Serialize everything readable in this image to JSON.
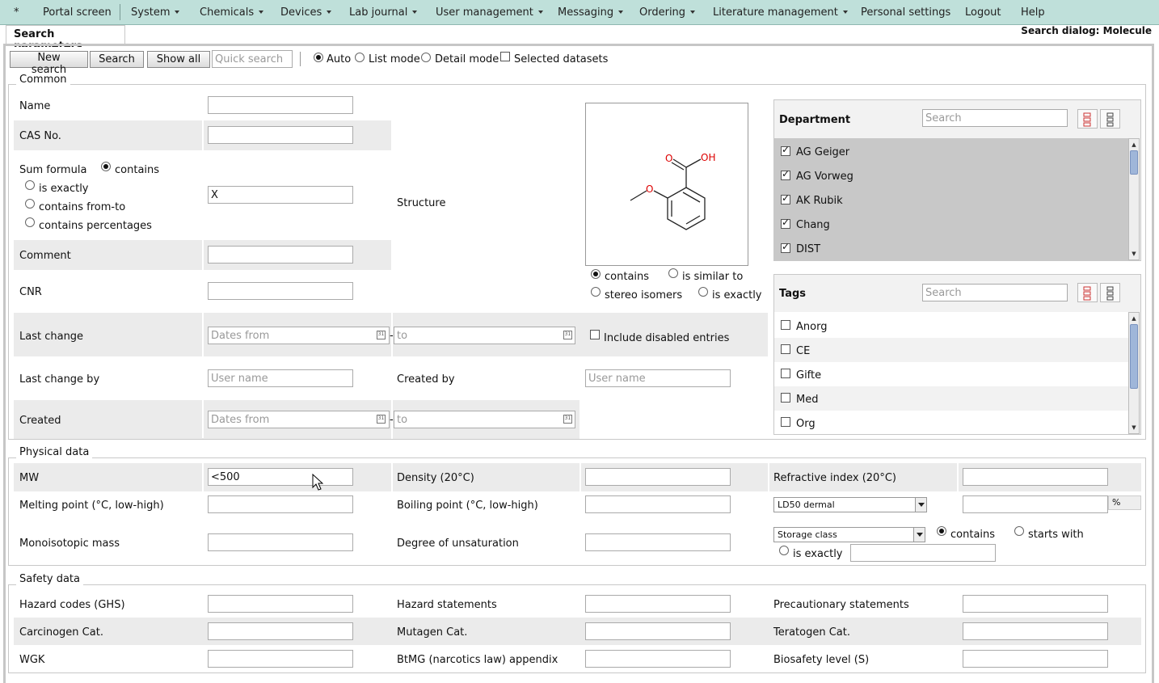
{
  "menu": {
    "home": "*",
    "items": [
      {
        "label": "Portal screen",
        "dropdown": false
      },
      {
        "label": "System",
        "dropdown": true
      },
      {
        "label": "Chemicals",
        "dropdown": true
      },
      {
        "label": "Devices",
        "dropdown": true
      },
      {
        "label": "Lab journal",
        "dropdown": true
      },
      {
        "label": "User management",
        "dropdown": true
      },
      {
        "label": "Messaging",
        "dropdown": true
      },
      {
        "label": "Ordering",
        "dropdown": true
      },
      {
        "label": "Literature management",
        "dropdown": true
      },
      {
        "label": "Personal settings",
        "dropdown": false
      },
      {
        "label": "Logout",
        "dropdown": false
      },
      {
        "label": "Help",
        "dropdown": false
      }
    ]
  },
  "tab": {
    "label": "Search parameters"
  },
  "dialog_title": "Search dialog: Molecule",
  "toolbar": {
    "new_search": "New search",
    "search": "Search",
    "show_all": "Show all",
    "quick_search_placeholder": "Quick search",
    "mode_auto": "Auto",
    "mode_list": "List mode",
    "mode_detail": "Detail mode",
    "mode_selected": "auto",
    "selected_datasets": "Selected datasets",
    "selected_datasets_checked": false
  },
  "common": {
    "legend": "Common",
    "name_label": "Name",
    "name_value": "",
    "cas_label": "CAS No.",
    "cas_value": "",
    "sum_formula_label": "Sum formula",
    "sf_contains": "contains",
    "sf_is_exactly": "is exactly",
    "sf_from_to": "contains from-to",
    "sf_percentages": "contains percentages",
    "sf_selected": "contains",
    "sum_formula_value": "X",
    "structure_label": "Structure",
    "comment_label": "Comment",
    "comment_value": "",
    "cnr_label": "CNR",
    "cnr_value": "",
    "struct_contains": "contains",
    "struct_similar": "is similar to",
    "struct_stereo": "stereo isomers",
    "struct_exactly": "is exactly",
    "struct_selected": "contains",
    "last_change_label": "Last change",
    "dates_from_placeholder": "Dates from",
    "to_placeholder": "to",
    "date_dash": "-",
    "calendar_glyph": "31",
    "include_disabled": "Include disabled entries",
    "include_disabled_checked": false,
    "last_change_by_label": "Last change by",
    "user_name_placeholder": "User name",
    "created_by_label": "Created by",
    "created_label": "Created"
  },
  "molecule": {
    "atom_o1": "O",
    "atom_oh": "OH",
    "atom_o2": "O"
  },
  "department": {
    "title": "Department",
    "search_placeholder": "Search",
    "items": [
      {
        "label": "AG Geiger",
        "checked": true
      },
      {
        "label": "AG Vorweg",
        "checked": true
      },
      {
        "label": "AK Rubik",
        "checked": true
      },
      {
        "label": "Chang",
        "checked": true
      },
      {
        "label": "DIST",
        "checked": true
      }
    ]
  },
  "tags": {
    "title": "Tags",
    "search_placeholder": "Search",
    "items": [
      {
        "label": "Anorg",
        "checked": false
      },
      {
        "label": "CE",
        "checked": false
      },
      {
        "label": "Gifte",
        "checked": false
      },
      {
        "label": "Med",
        "checked": false
      },
      {
        "label": "Org",
        "checked": false
      }
    ]
  },
  "physical": {
    "legend": "Physical data",
    "mw_label": "MW",
    "mw_value": "<500",
    "density_label": "Density (20°C)",
    "refractive_label": "Refractive index (20°C)",
    "melting_label": "Melting point (°C, low-high)",
    "boiling_label": "Boiling point (°C, low-high)",
    "ld50_select": "LD50 dermal",
    "percent": "%",
    "mono_label": "Monoisotopic mass",
    "unsat_label": "Degree of unsaturation",
    "storage_select": "Storage class",
    "sc_contains": "contains",
    "sc_starts_with": "starts with",
    "sc_is_exactly": "is exactly",
    "sc_selected": "contains"
  },
  "safety": {
    "legend": "Safety data",
    "hazard_codes_label": "Hazard codes (GHS)",
    "hazard_statements_label": "Hazard statements",
    "precautionary_label": "Precautionary statements",
    "carcinogen_label": "Carcinogen Cat.",
    "mutagen_label": "Mutagen Cat.",
    "teratogen_label": "Teratogen Cat.",
    "wgk_label": "WGK",
    "btmg_label": "BtMG (narcotics law) appendix",
    "biosafety_label": "Biosafety level (S)"
  },
  "colors": {
    "menubar": "#bfe0da",
    "row_shade": "#ebebeb",
    "molecule_heteroatom": "#dd0000",
    "scroll_thumb": "#9fb6d9"
  }
}
